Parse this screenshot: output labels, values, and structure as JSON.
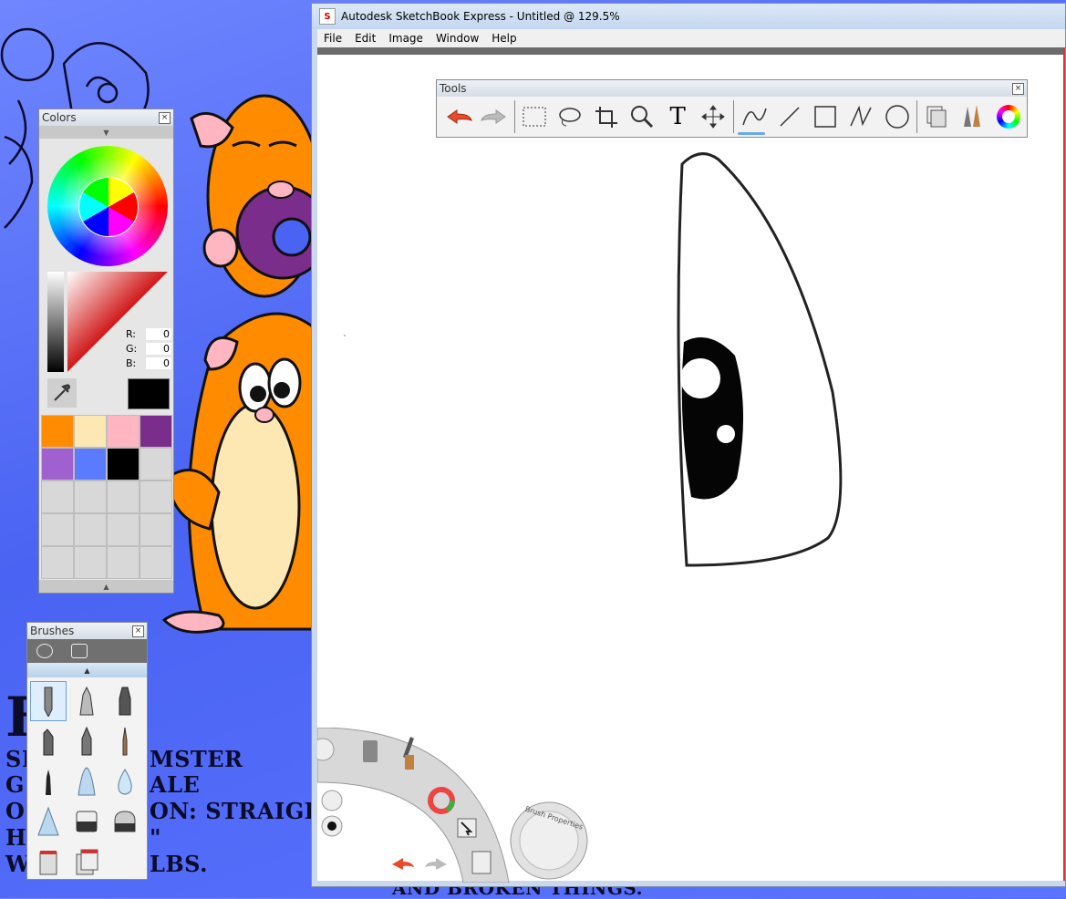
{
  "window": {
    "title": "Autodesk SketchBook Express - Untitled @ 129.5%",
    "icon": "sketchbook-app-icon"
  },
  "menu": [
    "File",
    "Edit",
    "Image",
    "Window",
    "Help"
  ],
  "tools_palette": {
    "title": "Tools",
    "tools": [
      "undo-icon",
      "redo-icon",
      "rect-select-icon",
      "lasso-icon",
      "crop-icon",
      "zoom-icon",
      "text-icon",
      "move-icon",
      "freehand-stroke-icon",
      "line-icon",
      "rectangle-icon",
      "polyline-icon",
      "ellipse-icon",
      "layers-icon",
      "brushes-icon",
      "color-wheel-icon"
    ],
    "text_tool_glyph": "T"
  },
  "colors_palette": {
    "title": "Colors",
    "rgb": {
      "r_label": "R:",
      "g_label": "G:",
      "b_label": "B:",
      "r": "0",
      "g": "0",
      "b": "0"
    },
    "current_color": "#000000",
    "swatches": [
      "#ff8c00",
      "#fde8b4",
      "#ffb6c1",
      "#7b2d8b",
      "#a060d0",
      "#5b7bff",
      "#000000",
      "#d8d8d8",
      "#d8d8d8",
      "#d8d8d8",
      "#d8d8d8",
      "#d8d8d8",
      "#d8d8d8",
      "#d8d8d8",
      "#d8d8d8",
      "#d8d8d8",
      "#d8d8d8",
      "#d8d8d8",
      "#d8d8d8",
      "#d8d8d8"
    ]
  },
  "brushes_palette": {
    "title": "Brushes",
    "brushes": [
      "pencil",
      "ink-pen",
      "marker",
      "chisel-marker",
      "ballpoint-pen",
      "paintbrush",
      "felt-pen",
      "airbrush",
      "water-drop",
      "cone-brush",
      "smudge",
      "eraser",
      "paint-bucket",
      "gradient-fill"
    ]
  },
  "lagoon": {
    "brush_properties_label": "Brush Properties"
  },
  "desktop_text": {
    "line1": "SE",
    "line1b": "MSTER",
    "line2": "G",
    "line2b": "ALE",
    "line3": "O",
    "line3b": "ON: STRAIGHT",
    "line4": "H",
    "line4b": "\"",
    "line5": "W",
    "line5b": "LBS.",
    "big_letter": "F",
    "bottom_text": "AND BROKEN THINGS."
  }
}
